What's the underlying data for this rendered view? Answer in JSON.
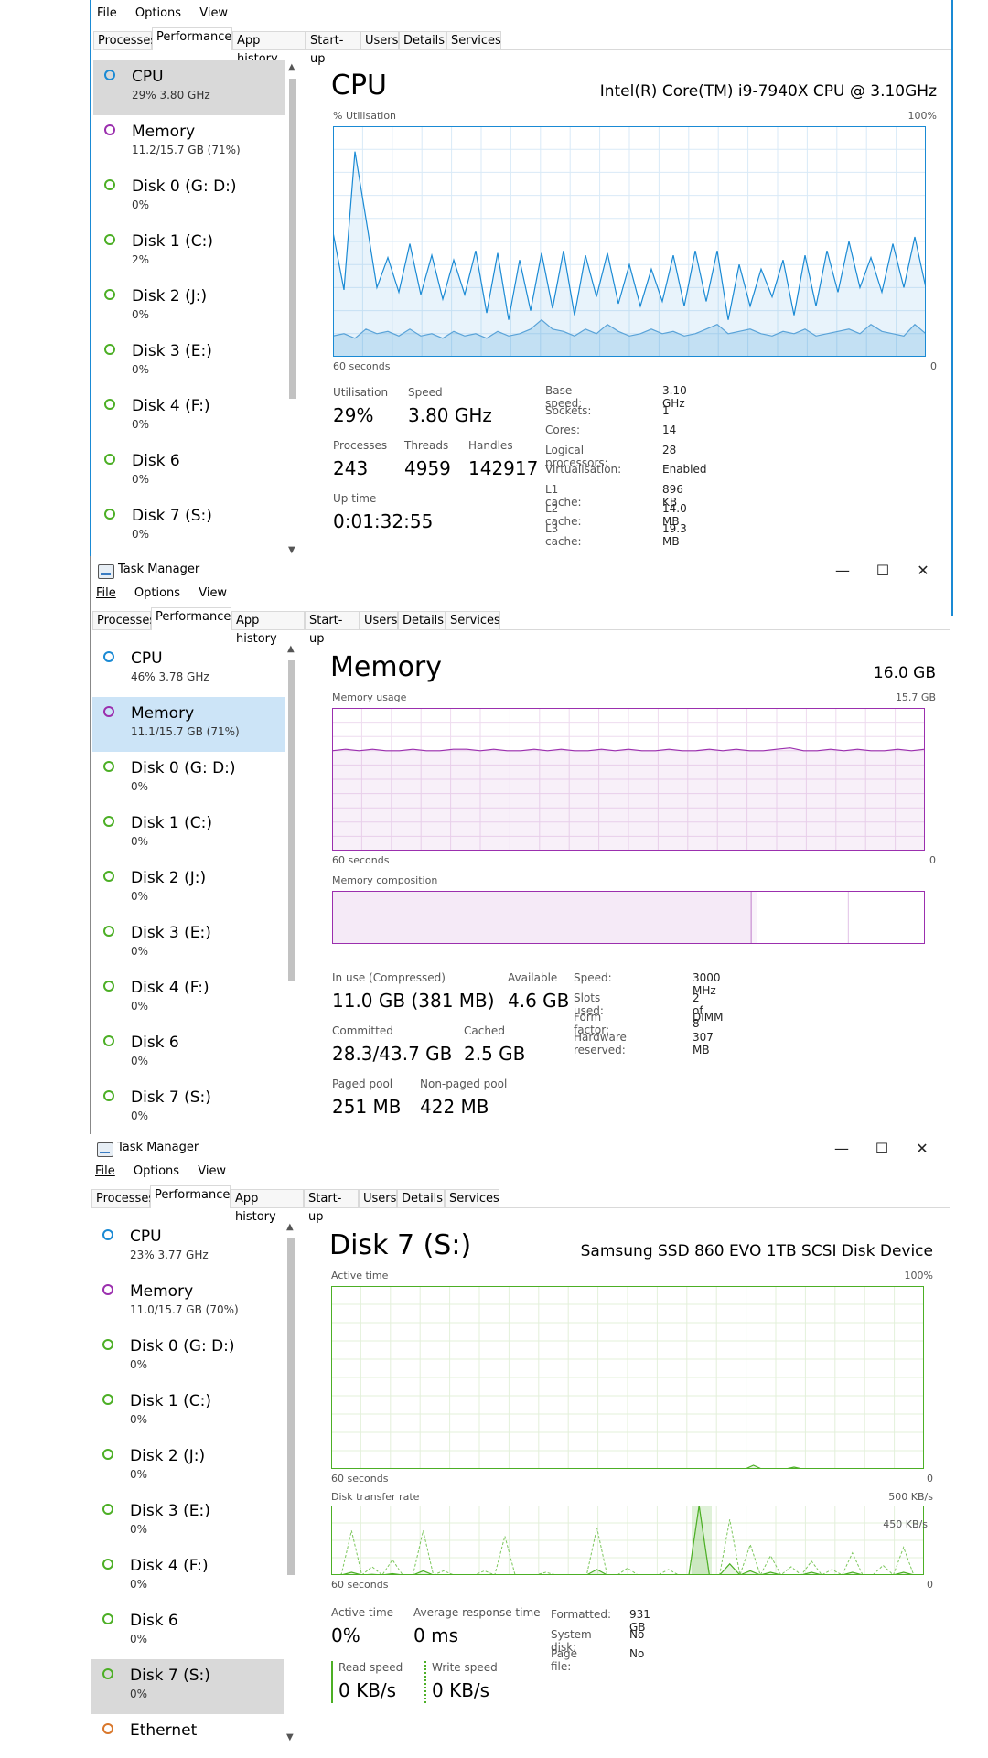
{
  "windows": [
    {
      "title": "",
      "menu": [
        "File",
        "Options",
        "View"
      ],
      "tabs": [
        "Processes",
        "Performance",
        "App history",
        "Start-up",
        "Users",
        "Details",
        "Services"
      ],
      "sidebar": [
        {
          "name": "CPU",
          "sub": "29%  3.80 GHz",
          "color": "#1a8ad4"
        },
        {
          "name": "Memory",
          "sub": "11.2/15.7 GB (71%)",
          "color": "#9b2fae"
        },
        {
          "name": "Disk 0 (G: D:)",
          "sub": "0%",
          "color": "#4caf25"
        },
        {
          "name": "Disk 1 (C:)",
          "sub": "2%",
          "color": "#4caf25"
        },
        {
          "name": "Disk 2 (J:)",
          "sub": "0%",
          "color": "#4caf25"
        },
        {
          "name": "Disk 3 (E:)",
          "sub": "0%",
          "color": "#4caf25"
        },
        {
          "name": "Disk 4 (F:)",
          "sub": "0%",
          "color": "#4caf25"
        },
        {
          "name": "Disk 6",
          "sub": "0%",
          "color": "#4caf25"
        },
        {
          "name": "Disk 7 (S:)",
          "sub": "0%",
          "color": "#4caf25"
        }
      ],
      "heading": "CPU",
      "model": "Intel(R) Core(TM) i9-7940X CPU @ 3.10GHz",
      "graph_label": "% Utilisation",
      "graph_max": "100%",
      "graph_time": "60 seconds",
      "graph_zero": "0",
      "stats": {
        "utilisation_label": "Utilisation",
        "utilisation": "29%",
        "speed_label": "Speed",
        "speed": "3.80 GHz",
        "processes_label": "Processes",
        "processes": "243",
        "threads_label": "Threads",
        "threads": "4959",
        "handles_label": "Handles",
        "handles": "142917",
        "uptime_label": "Up time",
        "uptime": "0:01:32:55"
      },
      "details": [
        {
          "k": "Base speed:",
          "v": "3.10 GHz"
        },
        {
          "k": "Sockets:",
          "v": "1"
        },
        {
          "k": "Cores:",
          "v": "14"
        },
        {
          "k": "Logical processors:",
          "v": "28"
        },
        {
          "k": "Virtualisation:",
          "v": "Enabled"
        },
        {
          "k": "L1 cache:",
          "v": "896 KB"
        },
        {
          "k": "L2 cache:",
          "v": "14.0 MB"
        },
        {
          "k": "L3 cache:",
          "v": "19.3 MB"
        }
      ],
      "cpu_history_pct": [
        54,
        29,
        89,
        60,
        30,
        43,
        28,
        49,
        27,
        44,
        25,
        42,
        27,
        46,
        19,
        45,
        16,
        42,
        20,
        45,
        21,
        46,
        18,
        44,
        26,
        45,
        23,
        40,
        22,
        38,
        24,
        44,
        22,
        46,
        24,
        46,
        16,
        40,
        22,
        38,
        26,
        42,
        18,
        44,
        22,
        46,
        28,
        50,
        30,
        43,
        28,
        49,
        30,
        52,
        30
      ],
      "cpu_kernel_pct": [
        9,
        10,
        8,
        12,
        10,
        11,
        9,
        12,
        9,
        10,
        8,
        11,
        9,
        10,
        8,
        11,
        9,
        10,
        12,
        16,
        12,
        11,
        9,
        12,
        10,
        14,
        11,
        9,
        10,
        12,
        10,
        11,
        9,
        10,
        12,
        14,
        10,
        11,
        12,
        10,
        9,
        11,
        10,
        12,
        9,
        10,
        11,
        12,
        10,
        14,
        11,
        10,
        9,
        14,
        10
      ]
    },
    {
      "title": "Task Manager",
      "menu": [
        "File",
        "Options",
        "View"
      ],
      "tabs": [
        "Processes",
        "Performance",
        "App history",
        "Start-up",
        "Users",
        "Details",
        "Services"
      ],
      "sidebar": [
        {
          "name": "CPU",
          "sub": "46%  3.78 GHz",
          "color": "#1a8ad4"
        },
        {
          "name": "Memory",
          "sub": "11.1/15.7 GB (71%)",
          "color": "#9b2fae"
        },
        {
          "name": "Disk 0 (G: D:)",
          "sub": "0%",
          "color": "#4caf25"
        },
        {
          "name": "Disk 1 (C:)",
          "sub": "0%",
          "color": "#4caf25"
        },
        {
          "name": "Disk 2 (J:)",
          "sub": "0%",
          "color": "#4caf25"
        },
        {
          "name": "Disk 3 (E:)",
          "sub": "0%",
          "color": "#4caf25"
        },
        {
          "name": "Disk 4 (F:)",
          "sub": "0%",
          "color": "#4caf25"
        },
        {
          "name": "Disk 6",
          "sub": "0%",
          "color": "#4caf25"
        },
        {
          "name": "Disk 7 (S:)",
          "sub": "0%",
          "color": "#4caf25"
        }
      ],
      "heading": "Memory",
      "model": "16.0 GB",
      "graph_label": "Memory usage",
      "graph_max": "15.7 GB",
      "graph_time": "60 seconds",
      "graph_zero": "0",
      "composition_label": "Memory composition",
      "stats": {
        "inuse_label": "In use (Compressed)",
        "inuse": "11.0 GB (381 MB)",
        "available_label": "Available",
        "available": "4.6 GB",
        "committed_label": "Committed",
        "committed": "28.3/43.7 GB",
        "cached_label": "Cached",
        "cached": "2.5 GB",
        "paged_label": "Paged pool",
        "paged": "251 MB",
        "nonpaged_label": "Non-paged pool",
        "nonpaged": "422 MB"
      },
      "details": [
        {
          "k": "Speed:",
          "v": "3000 MHz"
        },
        {
          "k": "Slots used:",
          "v": "2 of 8"
        },
        {
          "k": "Form factor:",
          "v": "DIMM"
        },
        {
          "k": "Hardware reserved:",
          "v": "307 MB"
        }
      ],
      "mem_history_pct": [
        70,
        71,
        70,
        71,
        70,
        70,
        71,
        70,
        70,
        71,
        71,
        70,
        71,
        70,
        70,
        71,
        70,
        71,
        70,
        70,
        71,
        70,
        71,
        70,
        70,
        71,
        70,
        70,
        71,
        70,
        71,
        70,
        70,
        71,
        72,
        70,
        70,
        71,
        70,
        71,
        70,
        70,
        71,
        70,
        71
      ],
      "mem_composition_pct": {
        "in_use": 70.7,
        "modified": 1.0,
        "standby": 15.4,
        "free": 12.9
      }
    },
    {
      "title": "Task Manager",
      "menu": [
        "File",
        "Options",
        "View"
      ],
      "tabs": [
        "Processes",
        "Performance",
        "App history",
        "Start-up",
        "Users",
        "Details",
        "Services"
      ],
      "sidebar": [
        {
          "name": "CPU",
          "sub": "23%  3.77 GHz",
          "color": "#1a8ad4"
        },
        {
          "name": "Memory",
          "sub": "11.0/15.7 GB (70%)",
          "color": "#9b2fae"
        },
        {
          "name": "Disk 0 (G: D:)",
          "sub": "0%",
          "color": "#4caf25"
        },
        {
          "name": "Disk 1 (C:)",
          "sub": "0%",
          "color": "#4caf25"
        },
        {
          "name": "Disk 2 (J:)",
          "sub": "0%",
          "color": "#4caf25"
        },
        {
          "name": "Disk 3 (E:)",
          "sub": "0%",
          "color": "#4caf25"
        },
        {
          "name": "Disk 4 (F:)",
          "sub": "0%",
          "color": "#4caf25"
        },
        {
          "name": "Disk 6",
          "sub": "0%",
          "color": "#4caf25"
        },
        {
          "name": "Disk 7 (S:)",
          "sub": "0%",
          "color": "#4caf25"
        },
        {
          "name": "Ethernet",
          "sub": "",
          "color": "#d9772b"
        }
      ],
      "heading": "Disk 7 (S:)",
      "model": "Samsung SSD 860 EVO 1TB SCSI Disk Device",
      "graph_label": "Active time",
      "graph_max": "100%",
      "graph_time": "60 seconds",
      "graph_zero": "0",
      "transfer_label": "Disk transfer rate",
      "transfer_max": "500 KB/s",
      "transfer_inner": "450 KB/s",
      "transfer_time": "60 seconds",
      "transfer_zero": "0",
      "stats": {
        "active_label": "Active time",
        "active": "0%",
        "resp_label": "Average response time",
        "resp": "0 ms",
        "read_label": "Read speed",
        "read": "0 KB/s",
        "write_label": "Write speed",
        "write": "0 KB/s"
      },
      "details": [
        {
          "k": "Formatted:",
          "v": "931 GB"
        },
        {
          "k": "System disk:",
          "v": "No"
        },
        {
          "k": "Page file:",
          "v": "No"
        }
      ],
      "disk_active_pct": [
        0,
        0,
        0,
        0,
        0,
        0,
        0,
        0,
        0,
        0,
        0,
        0,
        0,
        0,
        0,
        0,
        0,
        0,
        0,
        0,
        0,
        0,
        0,
        0,
        0,
        0,
        0,
        0,
        0,
        0,
        0,
        0,
        0,
        0,
        0,
        0,
        0,
        0,
        0,
        0,
        0,
        0,
        0,
        0,
        0,
        0,
        0,
        0,
        0,
        0,
        0,
        0,
        2,
        0,
        0,
        0,
        0,
        1,
        0,
        0,
        0,
        0,
        0,
        0,
        0,
        0,
        0,
        0,
        0,
        0,
        0,
        0,
        0,
        0
      ],
      "disk_transfer_kbs": [
        0,
        5,
        320,
        0,
        60,
        0,
        110,
        0,
        0,
        320,
        0,
        30,
        0,
        0,
        0,
        30,
        0,
        280,
        0,
        0,
        0,
        20,
        0,
        0,
        0,
        0,
        340,
        0,
        0,
        50,
        0,
        0,
        0,
        40,
        0,
        0,
        500,
        0,
        0,
        400,
        0,
        220,
        0,
        140,
        0,
        60,
        0,
        100,
        0,
        40,
        0,
        160,
        0,
        0,
        70,
        0,
        200,
        0,
        0
      ],
      "disk_transfer_write_kbs": [
        0,
        0,
        20,
        0,
        5,
        0,
        10,
        0,
        0,
        30,
        0,
        0,
        0,
        0,
        0,
        0,
        0,
        0,
        0,
        0,
        0,
        0,
        0,
        0,
        0,
        0,
        40,
        0,
        0,
        0,
        0,
        0,
        0,
        0,
        0,
        0,
        500,
        0,
        0,
        80,
        0,
        30,
        0,
        20,
        0,
        0,
        0,
        20,
        0,
        0,
        0,
        20,
        0,
        0,
        0,
        0,
        20,
        0,
        0
      ]
    }
  ],
  "colors": {
    "cpu": "#1a8ad4",
    "memory": "#9b2fae",
    "disk": "#4caf25",
    "ethernet": "#d9772b"
  }
}
